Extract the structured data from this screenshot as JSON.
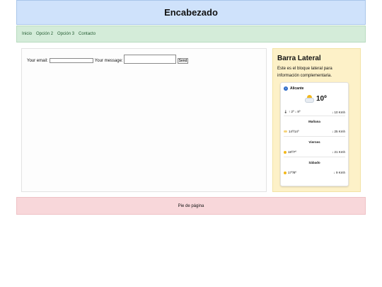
{
  "header": {
    "title": "Encabezado"
  },
  "nav": {
    "items": [
      "Inicio",
      "Opción 2",
      "Opción 3",
      "Contacto"
    ]
  },
  "form": {
    "email_label": "Your email:",
    "email_value": "",
    "message_label": "Your message:",
    "message_value": "",
    "send_label": "Send"
  },
  "sidebar": {
    "title": "Barra Lateral",
    "text": "Este es el bloque lateral para información complementaria."
  },
  "weather": {
    "city": "Alicante",
    "current_temp": "10º",
    "today": {
      "high": "↑ 2º",
      "low": "↓ 8º",
      "wind": "↓ 10 Kmh"
    },
    "days": [
      {
        "name": "Mañana",
        "temps": "14º/14º",
        "wind": "↓ 25 Kmh",
        "icon": "cloud-sun-icon"
      },
      {
        "name": "Viernes",
        "temps": "18º/7º",
        "wind": "↓ 21 Kmh",
        "icon": "sun-icon"
      },
      {
        "name": "Sábado",
        "temps": "17º/8º",
        "wind": "↓ 9 Kmh",
        "icon": "sun-icon"
      }
    ]
  },
  "footer": {
    "text": "Pie de página"
  },
  "colors": {
    "header_bg": "#cfe2fb",
    "nav_bg": "#d4ecd9",
    "sidebar_bg": "#fdf1c8",
    "footer_bg": "#f8d7da",
    "sun": "#f3b81a"
  }
}
